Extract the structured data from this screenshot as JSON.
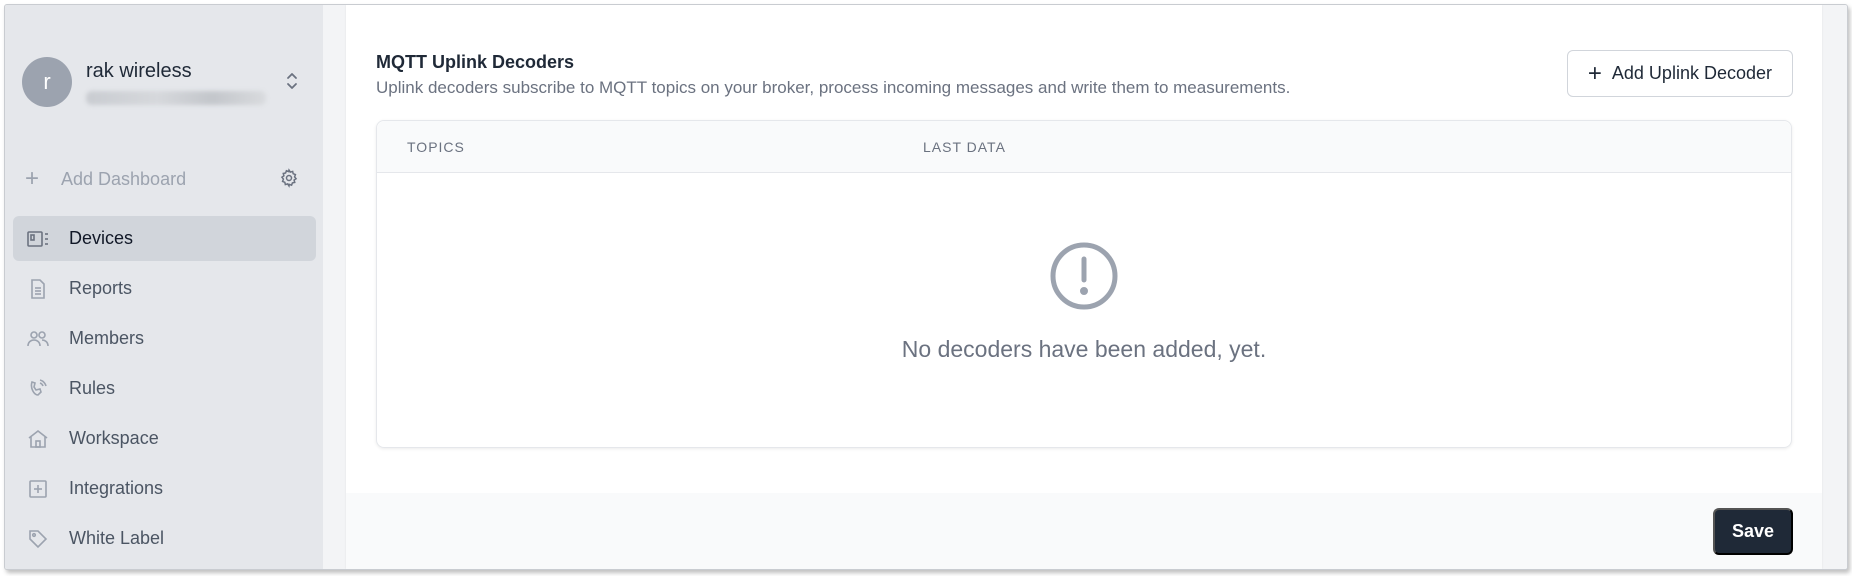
{
  "account": {
    "avatar_letter": "r",
    "name": "rak wireless"
  },
  "sidebar": {
    "add_dashboard_label": "Add Dashboard",
    "items": [
      {
        "label": "Devices",
        "icon": "devices-icon",
        "active": true
      },
      {
        "label": "Reports",
        "icon": "report-icon",
        "active": false
      },
      {
        "label": "Members",
        "icon": "members-icon",
        "active": false
      },
      {
        "label": "Rules",
        "icon": "rules-icon",
        "active": false
      },
      {
        "label": "Workspace",
        "icon": "workspace-icon",
        "active": false
      },
      {
        "label": "Integrations",
        "icon": "integrations-icon",
        "active": false
      },
      {
        "label": "White Label",
        "icon": "tag-icon",
        "active": false
      }
    ]
  },
  "main": {
    "title": "MQTT Uplink Decoders",
    "subtitle": "Uplink decoders subscribe to MQTT topics on your broker, process incoming messages and write them to measurements.",
    "add_button_label": "Add Uplink Decoder",
    "table": {
      "columns": [
        "TOPICS",
        "LAST DATA"
      ],
      "empty_message": "No decoders have been added, yet."
    },
    "save_label": "Save"
  },
  "colors": {
    "sidebar_bg": "#e5e7eb",
    "active_item_bg": "#d1d5db",
    "primary_button": "#1f2937"
  }
}
